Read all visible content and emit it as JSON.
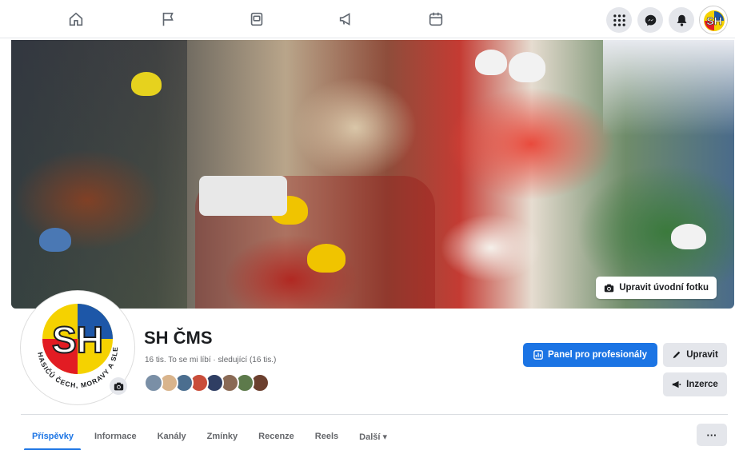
{
  "nav": {
    "icons": [
      "home-icon",
      "flag-icon",
      "gaming-icon",
      "megaphone-icon",
      "calendar-icon"
    ],
    "right_icons": [
      "menu-grid-icon",
      "messenger-icon",
      "bell-icon"
    ]
  },
  "cover": {
    "edit_label": "Upravit úvodní fotku"
  },
  "profile": {
    "logo_letters": "SH",
    "logo_ring_text": "HASIČŮ ČECH, MORAVY A SLEZSKA",
    "name": "SH ČMS",
    "likes_text": "16 tis. To se mi líbí · sledující (16 tis.)",
    "friend_colors": [
      "#7a8fa6",
      "#d9b48c",
      "#4b6e8f",
      "#c94d3a",
      "#2f3e63",
      "#8a6a55",
      "#5d7a4b",
      "#6b3f2e"
    ]
  },
  "actions": {
    "professional_label": "Panel pro profesionály",
    "edit_label": "Upravit",
    "ads_label": "Inzerce",
    "more_label": "···"
  },
  "tabs": [
    {
      "label": "Příspěvky",
      "active": true
    },
    {
      "label": "Informace",
      "active": false
    },
    {
      "label": "Kanály",
      "active": false
    },
    {
      "label": "Zmínky",
      "active": false
    },
    {
      "label": "Recenze",
      "active": false
    },
    {
      "label": "Reels",
      "active": false
    },
    {
      "label": "Další ▾",
      "active": false
    }
  ],
  "colors": {
    "accent": "#1b74e4",
    "logo_yellow": "#f5d200",
    "logo_blue": "#1d57a8",
    "logo_red": "#e21c23"
  }
}
